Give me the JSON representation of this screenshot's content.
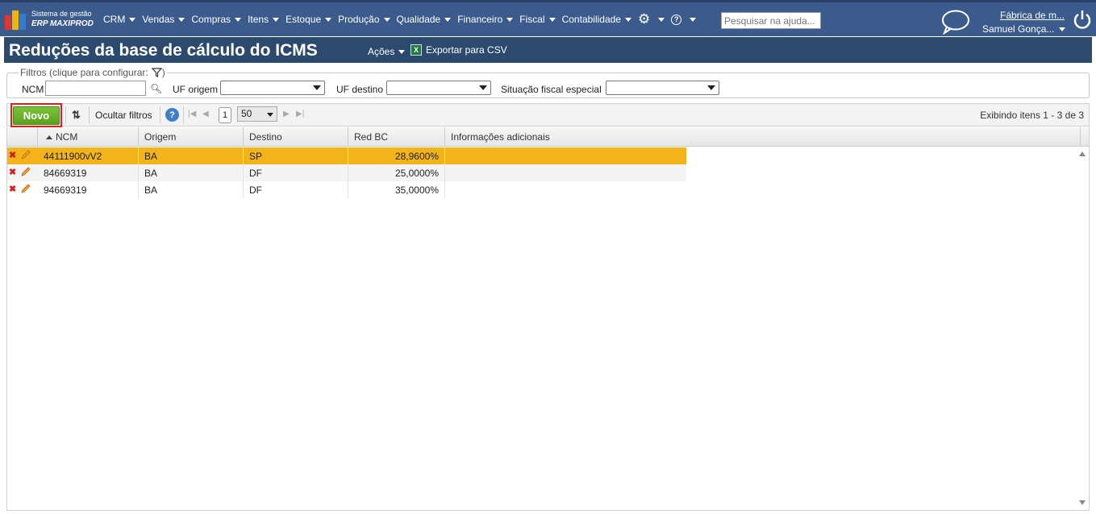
{
  "header": {
    "logo_line1": "Sistema de gestão",
    "logo_line2": "ERP MAXIPROD",
    "nav": [
      "CRM",
      "Vendas",
      "Compras",
      "Itens",
      "Estoque",
      "Produção",
      "Qualidade",
      "Financeiro",
      "Fiscal",
      "Contabilidade"
    ],
    "search_placeholder": "Pesquisar na ajuda...",
    "company": "Fábrica de m...",
    "user": "Samuel Gonça..."
  },
  "page": {
    "title": "Reduções da base de cálculo do ICMS",
    "actions_label": "Ações",
    "export_label": "Exportar para CSV"
  },
  "filters": {
    "legend": "Filtros (clique para configurar:",
    "ncm_label": "NCM",
    "uf_origem_label": "UF origem",
    "uf_destino_label": "UF destino",
    "situacao_label": "Situação fiscal especial"
  },
  "toolbar": {
    "novo_label": "Novo",
    "hide_filters_label": "Ocultar filtros",
    "current_page": "1",
    "page_size": "50",
    "count_text": "Exibindo itens 1 - 3 de 3"
  },
  "grid": {
    "columns": [
      "NCM",
      "Origem",
      "Destino",
      "Red BC",
      "Informações adicionais"
    ],
    "rows": [
      {
        "ncm": "44111900vV2",
        "origem": "BA",
        "destino": "SP",
        "red_bc": "28,9600%",
        "info": ""
      },
      {
        "ncm": "84669319",
        "origem": "BA",
        "destino": "DF",
        "red_bc": "25,0000%",
        "info": ""
      },
      {
        "ncm": "94669319",
        "origem": "BA",
        "destino": "DF",
        "red_bc": "35,0000%",
        "info": ""
      }
    ]
  },
  "colors": {
    "topbar": "#3b5b8d",
    "titlebar": "#2c4a6e",
    "selected_row": "#f3b31a",
    "novo_button": "#6bb02b",
    "highlight_outline": "#d91f1f"
  }
}
